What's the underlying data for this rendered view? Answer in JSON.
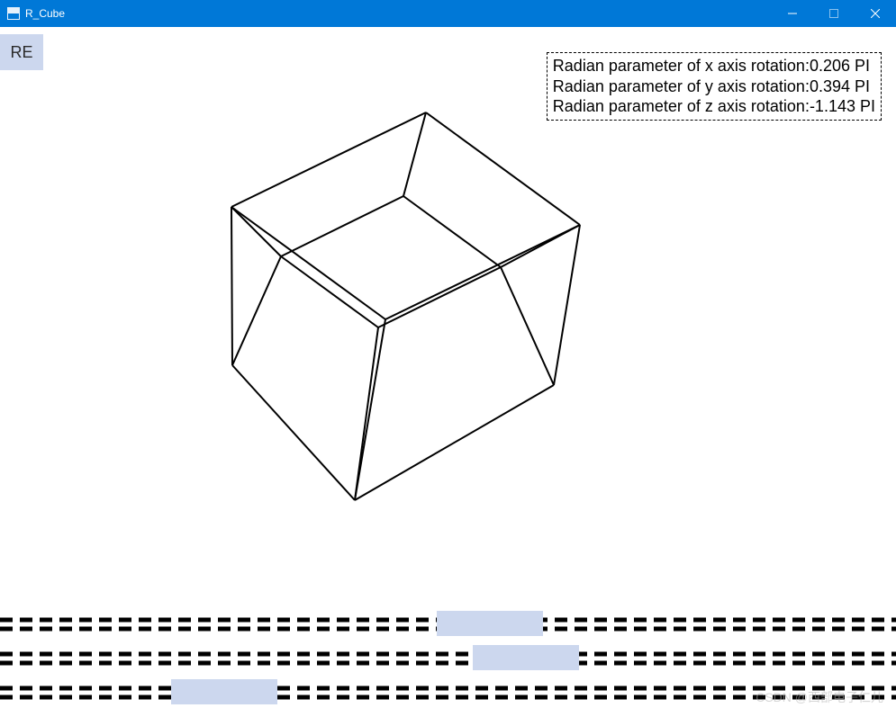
{
  "window": {
    "title": "R_Cube"
  },
  "buttons": {
    "reset_label": "RE"
  },
  "params": {
    "x_label": "Radian parameter of x axis rotation:0.206 PI",
    "y_label": "Radian parameter of y axis rotation:0.394 PI",
    "z_label": "Radian parameter of z axis rotation:-1.143 PI"
  },
  "rotation": {
    "x_pi": 0.206,
    "y_pi": 0.394,
    "z_pi": -1.143
  },
  "sliders": {
    "x": {
      "min": -2,
      "max": 2,
      "value": 0.206
    },
    "y": {
      "min": -2,
      "max": 2,
      "value": 0.394
    },
    "z": {
      "min": -2,
      "max": 2,
      "value": -1.143
    }
  },
  "watermark": "CSDN @西部电子仁儿"
}
